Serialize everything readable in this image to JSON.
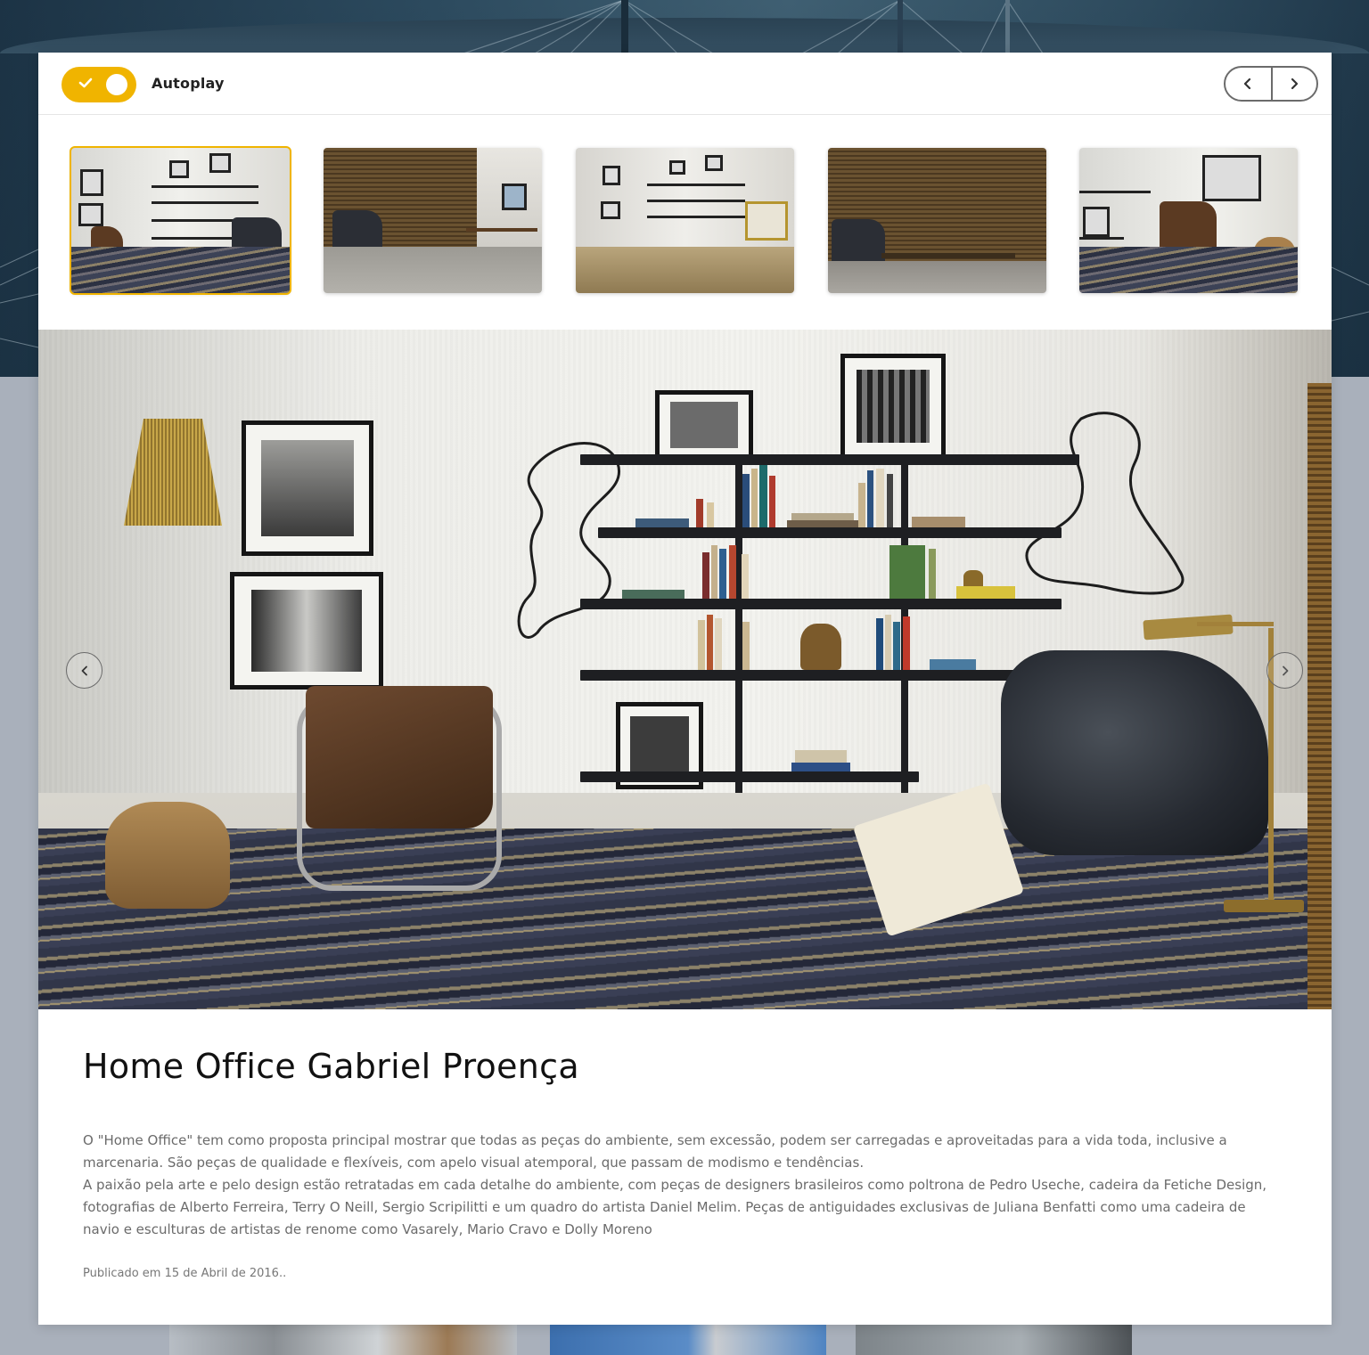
{
  "colors": {
    "accent": "#f0b400",
    "title": "#111111",
    "body_text": "#6b6b6b",
    "card_bg": "#ffffff",
    "page_bg": "#a9b0bb"
  },
  "toolbar": {
    "autoplay_label": "Autoplay",
    "autoplay_on": true,
    "toggle_icon": "check-icon",
    "prev_icon": "chevron-left-icon",
    "next_icon": "chevron-right-icon"
  },
  "thumbnails": {
    "count": 5,
    "active_index": 0
  },
  "slide": {
    "prev_icon": "chevron-left-icon",
    "next_icon": "chevron-right-icon"
  },
  "article": {
    "title": "Home Office Gabriel Proença",
    "paragraph_1": "O \"Home Office\" tem como proposta principal mostrar que todas as peças do ambiente, sem excessão, podem ser carregadas e aproveitadas para a vida toda, inclusive a marcenaria. São peças de qualidade e flexíveis, com apelo visual atemporal, que passam de modismo e tendências.",
    "paragraph_2": "A paixão pela arte e pelo design estão retratadas em cada detalhe do ambiente, com peças de designers brasileiros como poltrona de Pedro Useche, cadeira da Fetiche Design, fotografias de Alberto Ferreira, Terry O Neill, Sergio Scripilitti e um quadro do artista Daniel Melim. Peças de antiguidades exclusivas de Juliana Benfatti como uma cadeira de navio e esculturas de artistas de renome como Vasarely, Mario Cravo e Dolly Moreno",
    "published": "Publicado em 15 de Abril de 2016.."
  }
}
